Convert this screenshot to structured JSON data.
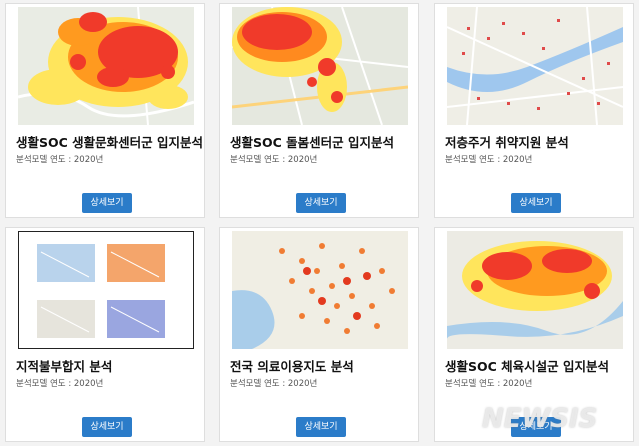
{
  "cards": [
    {
      "title": "생활SOC 생활문화센터군 입지분석",
      "meta": "분석모델 연도 : 2020년",
      "button": "상세보기"
    },
    {
      "title": "생활SOC 돌봄센터군 입지분석",
      "meta": "분석모델 연도 : 2020년",
      "button": "상세보기"
    },
    {
      "title": "저층주거 취약지원 분석",
      "meta": "분석모델 연도 : 2020년",
      "button": "상세보기"
    },
    {
      "title": "지적불부합지 분석",
      "meta": "분석모델 연도 : 2020년",
      "button": "상세보기"
    },
    {
      "title": "전국 의료이용지도 분석",
      "meta": "분석모델 연도 : 2020년",
      "button": "상세보기"
    },
    {
      "title": "생활SOC 체육시설군 입지분석",
      "meta": "분석모델 연도 : 2020년",
      "button": "상세보기"
    }
  ],
  "watermark": "NEWSIS"
}
